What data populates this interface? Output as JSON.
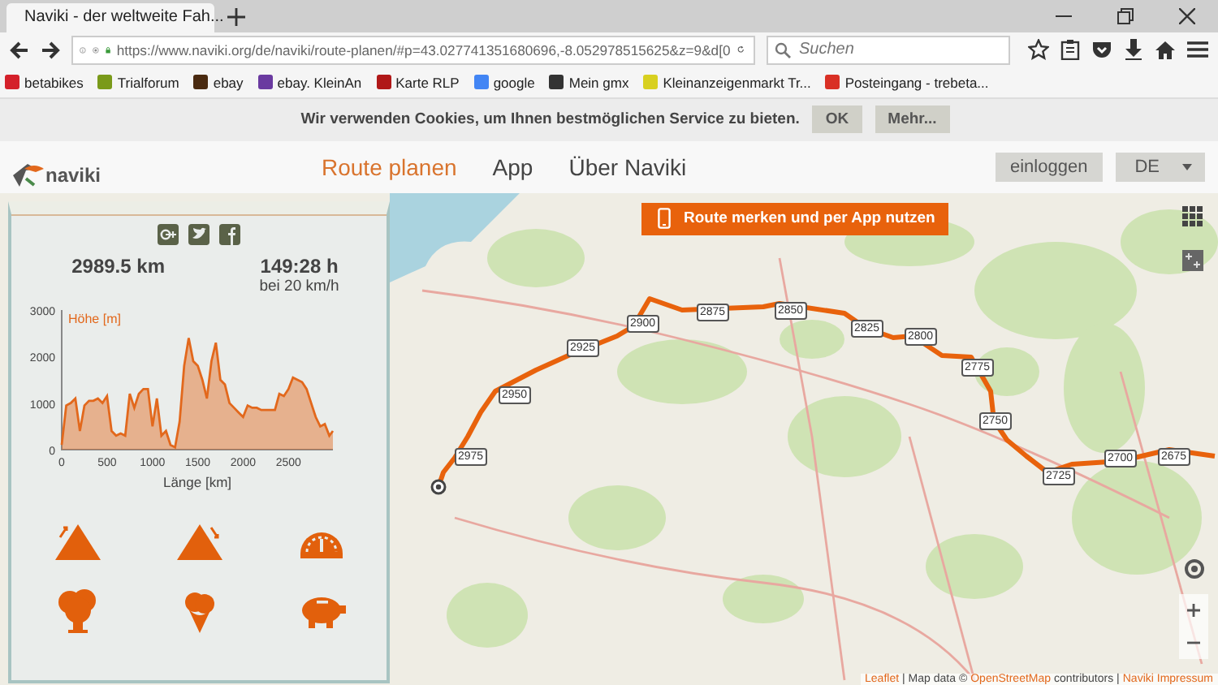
{
  "browser": {
    "tab": {
      "title": "Naviki - der weltweite Fah...",
      "selected": true
    },
    "url": "https://www.naviki.org/de/naviki/route-planen/#p=43.027741351680696,-8.052978515625&z=9&d[0",
    "search": {
      "placeholder": "Suchen"
    },
    "bookmarks": [
      {
        "label": "betabikes",
        "color": "#d4202a"
      },
      {
        "label": "Trialforum",
        "color": "#7a9a1a"
      },
      {
        "label": "ebay",
        "color": "#4a2a10"
      },
      {
        "label": "ebay. KleinAn",
        "color": "#6a3aa0"
      },
      {
        "label": "Karte RLP",
        "color": "#b01818"
      },
      {
        "label": "google",
        "color": "#4285f4"
      },
      {
        "label": "Mein gmx",
        "color": "#333333"
      },
      {
        "label": "Kleinanzeigenmarkt Tr...",
        "color": "#d8d020"
      },
      {
        "label": "Posteingang - trebeta...",
        "color": "#d93025"
      }
    ]
  },
  "cookie_banner": {
    "text": "Wir verwenden Cookies, um Ihnen bestmöglichen Service zu bieten.",
    "buttons": [
      "OK",
      "Mehr..."
    ]
  },
  "site_header": {
    "logo": "naviki",
    "nav": [
      {
        "label": "Route planen",
        "selected": true
      },
      {
        "label": "App",
        "selected": false
      },
      {
        "label": "Über Naviki",
        "selected": false
      }
    ],
    "login": "einloggen",
    "language": "DE"
  },
  "route_panel": {
    "distance": "2989.5 km",
    "duration": "149:28 h",
    "speed_note": "bei 20 km/h",
    "chart_data": {
      "type": "area",
      "xlabel": "Länge [km]",
      "xlim": [
        0,
        2990
      ],
      "ylim": [
        0,
        3000
      ],
      "xticks": [
        0,
        500,
        1000,
        1500,
        2000,
        2500
      ],
      "yticks": [
        0,
        1000,
        2000,
        3000
      ],
      "x": [
        0,
        50,
        100,
        150,
        200,
        250,
        300,
        350,
        400,
        450,
        500,
        550,
        600,
        650,
        700,
        750,
        800,
        850,
        900,
        950,
        1000,
        1050,
        1100,
        1150,
        1200,
        1250,
        1300,
        1350,
        1400,
        1450,
        1500,
        1550,
        1600,
        1650,
        1700,
        1750,
        1800,
        1850,
        1900,
        1950,
        2000,
        2050,
        2100,
        2150,
        2200,
        2250,
        2300,
        2350,
        2400,
        2450,
        2500,
        2550,
        2600,
        2650,
        2700,
        2750,
        2800,
        2850,
        2900,
        2950,
        2990
      ],
      "series": [
        {
          "name": "Höhe [m]",
          "color": "#e2681c",
          "values": [
            100,
            950,
            1000,
            1100,
            400,
            950,
            1050,
            1050,
            1100,
            1000,
            1150,
            400,
            300,
            350,
            300,
            1200,
            900,
            1200,
            1300,
            1300,
            500,
            1100,
            300,
            400,
            100,
            50,
            600,
            1800,
            2400,
            1900,
            1800,
            1500,
            1100,
            1900,
            2300,
            1500,
            1400,
            1000,
            900,
            800,
            700,
            950,
            900,
            900,
            850,
            850,
            850,
            850,
            1200,
            1150,
            1300,
            1550,
            1500,
            1450,
            1300,
            1000,
            700,
            500,
            550,
            300,
            400
          ]
        }
      ]
    }
  },
  "map": {
    "promo_button": "Route merken und per App nutzen",
    "route_markers": [
      "2975",
      "2950",
      "2925",
      "2900",
      "2875",
      "2850",
      "2825",
      "2800",
      "2775",
      "2750",
      "2725",
      "2700",
      "2675"
    ],
    "attribution": [
      {
        "kind": "link",
        "text": "Leaflet"
      },
      {
        "kind": "text",
        "text": "| Map data ©"
      },
      {
        "kind": "link",
        "text": "OpenStreetMap"
      },
      {
        "kind": "text",
        "text": "contributors |"
      },
      {
        "kind": "link",
        "text": "Naviki Impressum"
      }
    ]
  }
}
